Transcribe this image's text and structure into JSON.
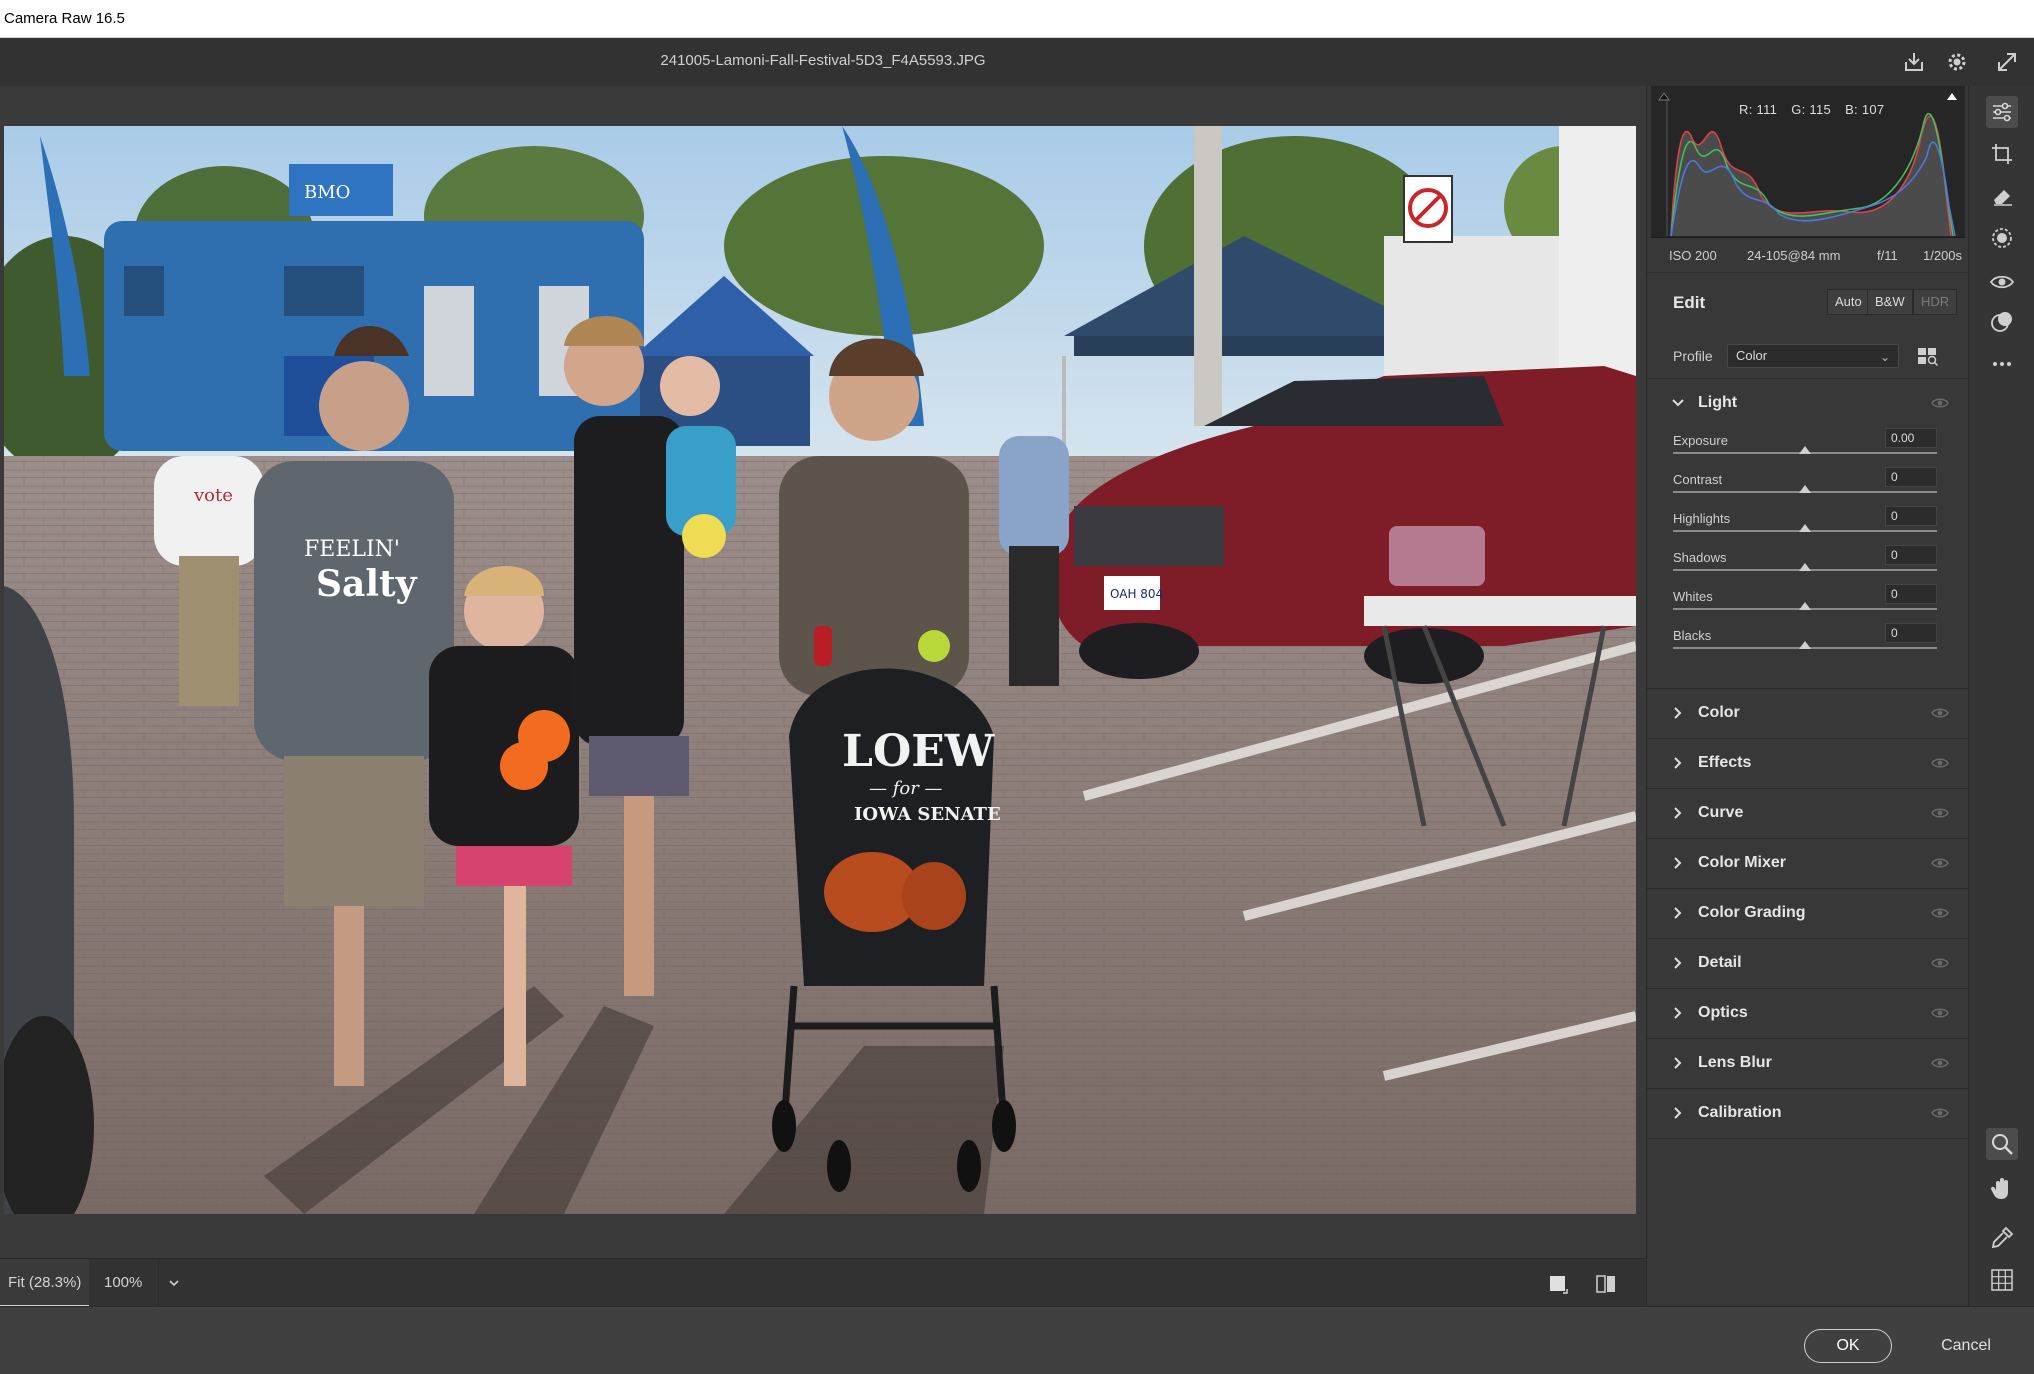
{
  "window": {
    "title": "Camera Raw 16.5"
  },
  "header": {
    "filename": "241005-Lamoni-Fall-Festival-5D3_F4A5593.JPG"
  },
  "zoom": {
    "fit_label": "Fit (28.3%)",
    "hundred_label": "100%"
  },
  "histogram": {
    "r_label": "R: 111",
    "g_label": "G: 115",
    "b_label": "B: 107"
  },
  "exif": {
    "iso": "ISO 200",
    "lens": "24-105@84 mm",
    "aperture": "f/11",
    "shutter": "1/200s"
  },
  "edit": {
    "title": "Edit",
    "auto_label": "Auto",
    "bw_label": "B&W",
    "hdr_label": "HDR"
  },
  "profile": {
    "label": "Profile",
    "value": "Color"
  },
  "light": {
    "title": "Light",
    "sliders": [
      {
        "label": "Exposure",
        "value": "0.00",
        "position": 0.5
      },
      {
        "label": "Contrast",
        "value": "0",
        "position": 0.5
      },
      {
        "label": "Highlights",
        "value": "0",
        "position": 0.5
      },
      {
        "label": "Shadows",
        "value": "0",
        "position": 0.5
      },
      {
        "label": "Whites",
        "value": "0",
        "position": 0.5
      },
      {
        "label": "Blacks",
        "value": "0",
        "position": 0.5
      }
    ]
  },
  "sections": [
    {
      "label": "Color"
    },
    {
      "label": "Effects"
    },
    {
      "label": "Curve"
    },
    {
      "label": "Color Mixer"
    },
    {
      "label": "Color Grading"
    },
    {
      "label": "Detail"
    },
    {
      "label": "Optics"
    },
    {
      "label": "Lens Blur"
    },
    {
      "label": "Calibration"
    }
  ],
  "footer": {
    "ok_label": "OK",
    "cancel_label": "Cancel"
  },
  "photo": {
    "bank_sign": "BMO",
    "vote_text": "vote",
    "stroller_text_1": "LOEW",
    "stroller_text_2": "— for —",
    "stroller_text_3": "IOWA SENATE",
    "shirt_text_1": "FEELIN'",
    "shirt_text_2": "Salty",
    "plate_text": "OAH 804"
  },
  "colors": {
    "panel_bg": "#383838",
    "histogram_red": "#e0404a",
    "histogram_green": "#3fc05a",
    "histogram_blue": "#4a78e0"
  }
}
